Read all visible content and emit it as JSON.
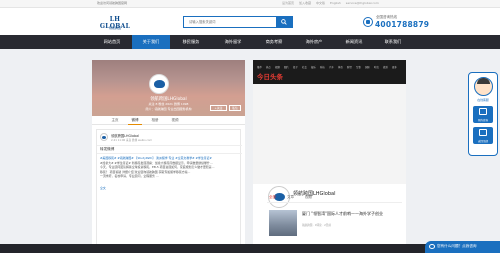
{
  "topbar": {
    "welcome": "欢迎访问领航跨国官网",
    "links": [
      "设为首页",
      "加入收藏",
      "中文版",
      "English",
      "service@lhglobal.com"
    ]
  },
  "header": {
    "logo_text": "LH GLOBAL",
    "logo_sub": "领航跨国",
    "search_placeholder": "请输入搜索关键词",
    "hotline_label": "全国咨询热线",
    "hotline_number": "4001788879"
  },
  "nav": {
    "items": [
      {
        "label": "网站首页",
        "active": false
      },
      {
        "label": "关于我们",
        "active": true
      },
      {
        "label": "移民服务",
        "active": false
      },
      {
        "label": "海外留学",
        "active": false
      },
      {
        "label": "商务考察",
        "active": false
      },
      {
        "label": "海外房产",
        "active": false
      },
      {
        "label": "新闻资讯",
        "active": false
      },
      {
        "label": "联系我们",
        "active": false
      }
    ]
  },
  "weibo": {
    "username": "领航跨国LHGlobal",
    "stats": "关注 8   粉丝 2621   微博 1098",
    "desc": "简介：领航跨国 专业出国服务机构",
    "follow_label": "+关注",
    "message_label": "私信",
    "tabs": [
      {
        "label": "主页",
        "active": false
      },
      {
        "label": "微博",
        "active": true
      },
      {
        "label": "相册",
        "active": false
      },
      {
        "label": "视频",
        "active": false
      }
    ],
    "post": {
      "author": "领航跨国LHGlobal",
      "time": "2-21 11:06 来自 微博 weibo.com",
      "heading": "转发微博",
      "lines": [
        "#美国移民# #领航跨国# 【StudyPath】 澳洲留学 专业 #全英文教学# #学生签证#",
        "#加拿大# #学生签证# 新移民发展观察：加拿大移民局数据显示，申请数量继续攀升…",
        "今天，专业顾问团队解答全球投资移民，EB-5 项目进展如何，家庭规划怎么做才更稳妥…",
        "移民？ 项目答疑 详细介绍 欢迎咨询领航跨国 获取专属留学移民方案…",
        "一流学府，名校申请，专业顾问，全程服务 …"
      ],
      "more": "全文"
    }
  },
  "toutiao": {
    "logo": "今日头条",
    "nav": [
      "推荐",
      "热点",
      "视频",
      "图片",
      "段子",
      "社会",
      "娱乐",
      "科技",
      "汽车",
      "体育",
      "财经",
      "军事",
      "国际",
      "时尚",
      "旅游",
      "更多"
    ],
    "account": "领航跨国LHGlobal",
    "tabs": [
      {
        "label": "全部",
        "active": true
      },
      {
        "label": "文章",
        "active": false
      },
      {
        "label": "视频",
        "active": false
      }
    ],
    "article": {
      "title": "厦门 \"领智湾\"国际人才前哨——海外学子创业",
      "meta": "领航跨国 · 0评论 · 2天前"
    }
  },
  "sidebar": {
    "online": "在线客服",
    "btn1": "预约咨询",
    "btn2": "返回顶部"
  },
  "chat": {
    "label": "您有什么问题？点我咨询"
  },
  "colors": {
    "brand_blue": "#1a6fbf",
    "nav_bg": "#292a31",
    "toutiao_red": "#e23b33"
  }
}
